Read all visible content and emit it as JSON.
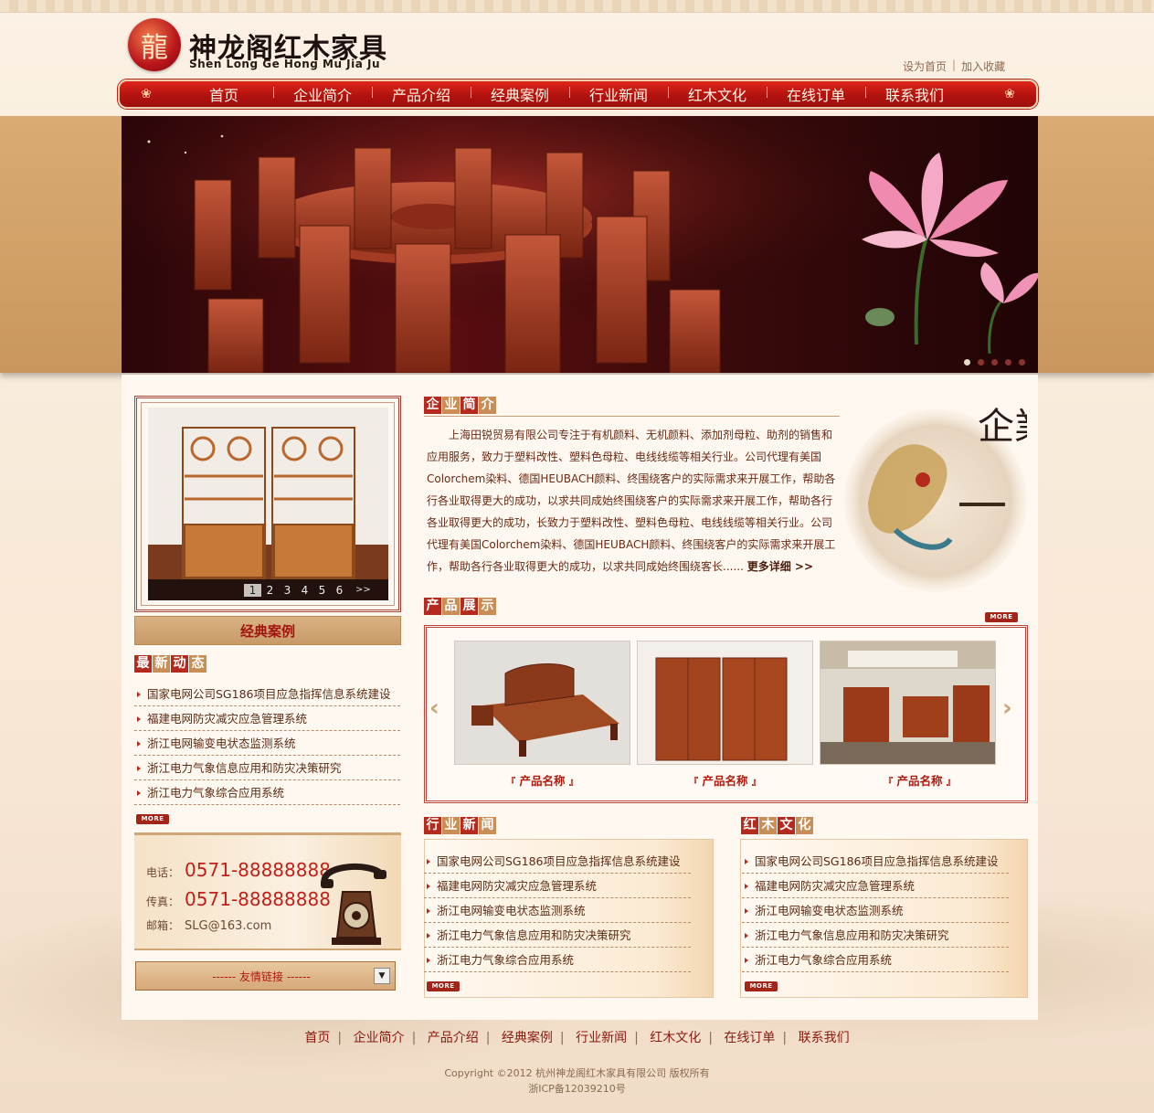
{
  "brand": {
    "name_cn": "神龙阁红木家具",
    "name_pinyin": "Shen Long Ge Hong Mu Jia Ju",
    "logo_icon": "dragon-emblem"
  },
  "top_links": {
    "set_home": "设为首页",
    "separator": "|",
    "add_favorite": "加入收藏"
  },
  "nav": {
    "items": [
      "首页",
      "企业简介",
      "产品介绍",
      "经典案例",
      "行业新闻",
      "红木文化",
      "在线订单",
      "联系我们"
    ]
  },
  "banner": {
    "dot_count": 5,
    "active_dot": 1
  },
  "showcase": {
    "pages": [
      "1",
      "2",
      "3",
      "4",
      "5",
      "6"
    ],
    "active_page": "1",
    "next": ">>",
    "title": "经典案例"
  },
  "latest": {
    "title_chars": [
      "最",
      "新",
      "动",
      "态"
    ],
    "items": [
      "国家电网公司SG186项目应急指挥信息系统建设",
      "福建电网防灾减灾应急管理系统",
      "浙江电网输变电状态监测系统",
      "浙江电力气象信息应用和防灾决策研究",
      "浙江电力气象综合应用系统"
    ],
    "more": "MORE"
  },
  "contact": {
    "tel_label": "电话：",
    "tel": "0571-88888888",
    "fax_label": "传真：",
    "fax": "0571-88888888",
    "email_label": "邮箱：",
    "email": "SLG@163.com"
  },
  "friend_links": {
    "label": "------ 友情链接 ------",
    "arrow": "▼"
  },
  "intro": {
    "title_chars": [
      "企",
      "业",
      "简",
      "介"
    ],
    "text": "上海田锐贸易有限公司专注于有机颜料、无机颜料、添加剂母粒、助剂的销售和应用服务，致力于塑料改性、塑料色母粒、电线线缆等相关行业。公司代理有美国Colorchem染料、德国HEUBACH颜料、终围绕客户的实际需求来开展工作，帮助各行各业取得更大的成功，以求共同成始终围绕客户的实际需求来开展工作，帮助各行各业取得更大的成功，长致力于塑料改性、塑料色母粒、电线线缆等相关行业。公司代理有美国Colorchem染料、德国HEUBACH颜料、终围绕客户的实际需求来开展工作，帮助各行各业取得更大的成功，以求共同成始终围绕客长......",
    "more": "更多详细 >>",
    "deco_text": "企業簡介"
  },
  "products": {
    "title_chars": [
      "产",
      "品",
      "展",
      "示"
    ],
    "more": "MORE",
    "items": [
      {
        "name": "产品名称"
      },
      {
        "name": "产品名称"
      },
      {
        "name": "产品名称"
      }
    ],
    "quote_open": "『",
    "quote_close": "』"
  },
  "industry_news": {
    "title_chars": [
      "行",
      "业",
      "新",
      "闻"
    ],
    "items": [
      "国家电网公司SG186项目应急指挥信息系统建设",
      "福建电网防灾减灾应急管理系统",
      "浙江电网输变电状态监测系统",
      "浙江电力气象信息应用和防灾决策研究",
      "浙江电力气象综合应用系统"
    ],
    "more": "MORE"
  },
  "culture": {
    "title_chars": [
      "红",
      "木",
      "文",
      "化"
    ],
    "items": [
      "国家电网公司SG186项目应急指挥信息系统建设",
      "福建电网防灾减灾应急管理系统",
      "浙江电网输变电状态监测系统",
      "浙江电力气象信息应用和防灾决策研究",
      "浙江电力气象综合应用系统"
    ],
    "more": "MORE"
  },
  "footer": {
    "nav": [
      "首页",
      "企业简介",
      "产品介绍",
      "经典案例",
      "行业新闻",
      "红木文化",
      "在线订单",
      "联系我们"
    ],
    "copyright": "Copyright ©2012 杭州神龙阁红木家具有限公司 版权所有",
    "icp": "浙ICP备12039210号"
  },
  "colors": {
    "nav_red": "#b3130f",
    "accent_red": "#b52a1d",
    "tan": "#c98e56",
    "page_bg": "#fbeee0"
  }
}
